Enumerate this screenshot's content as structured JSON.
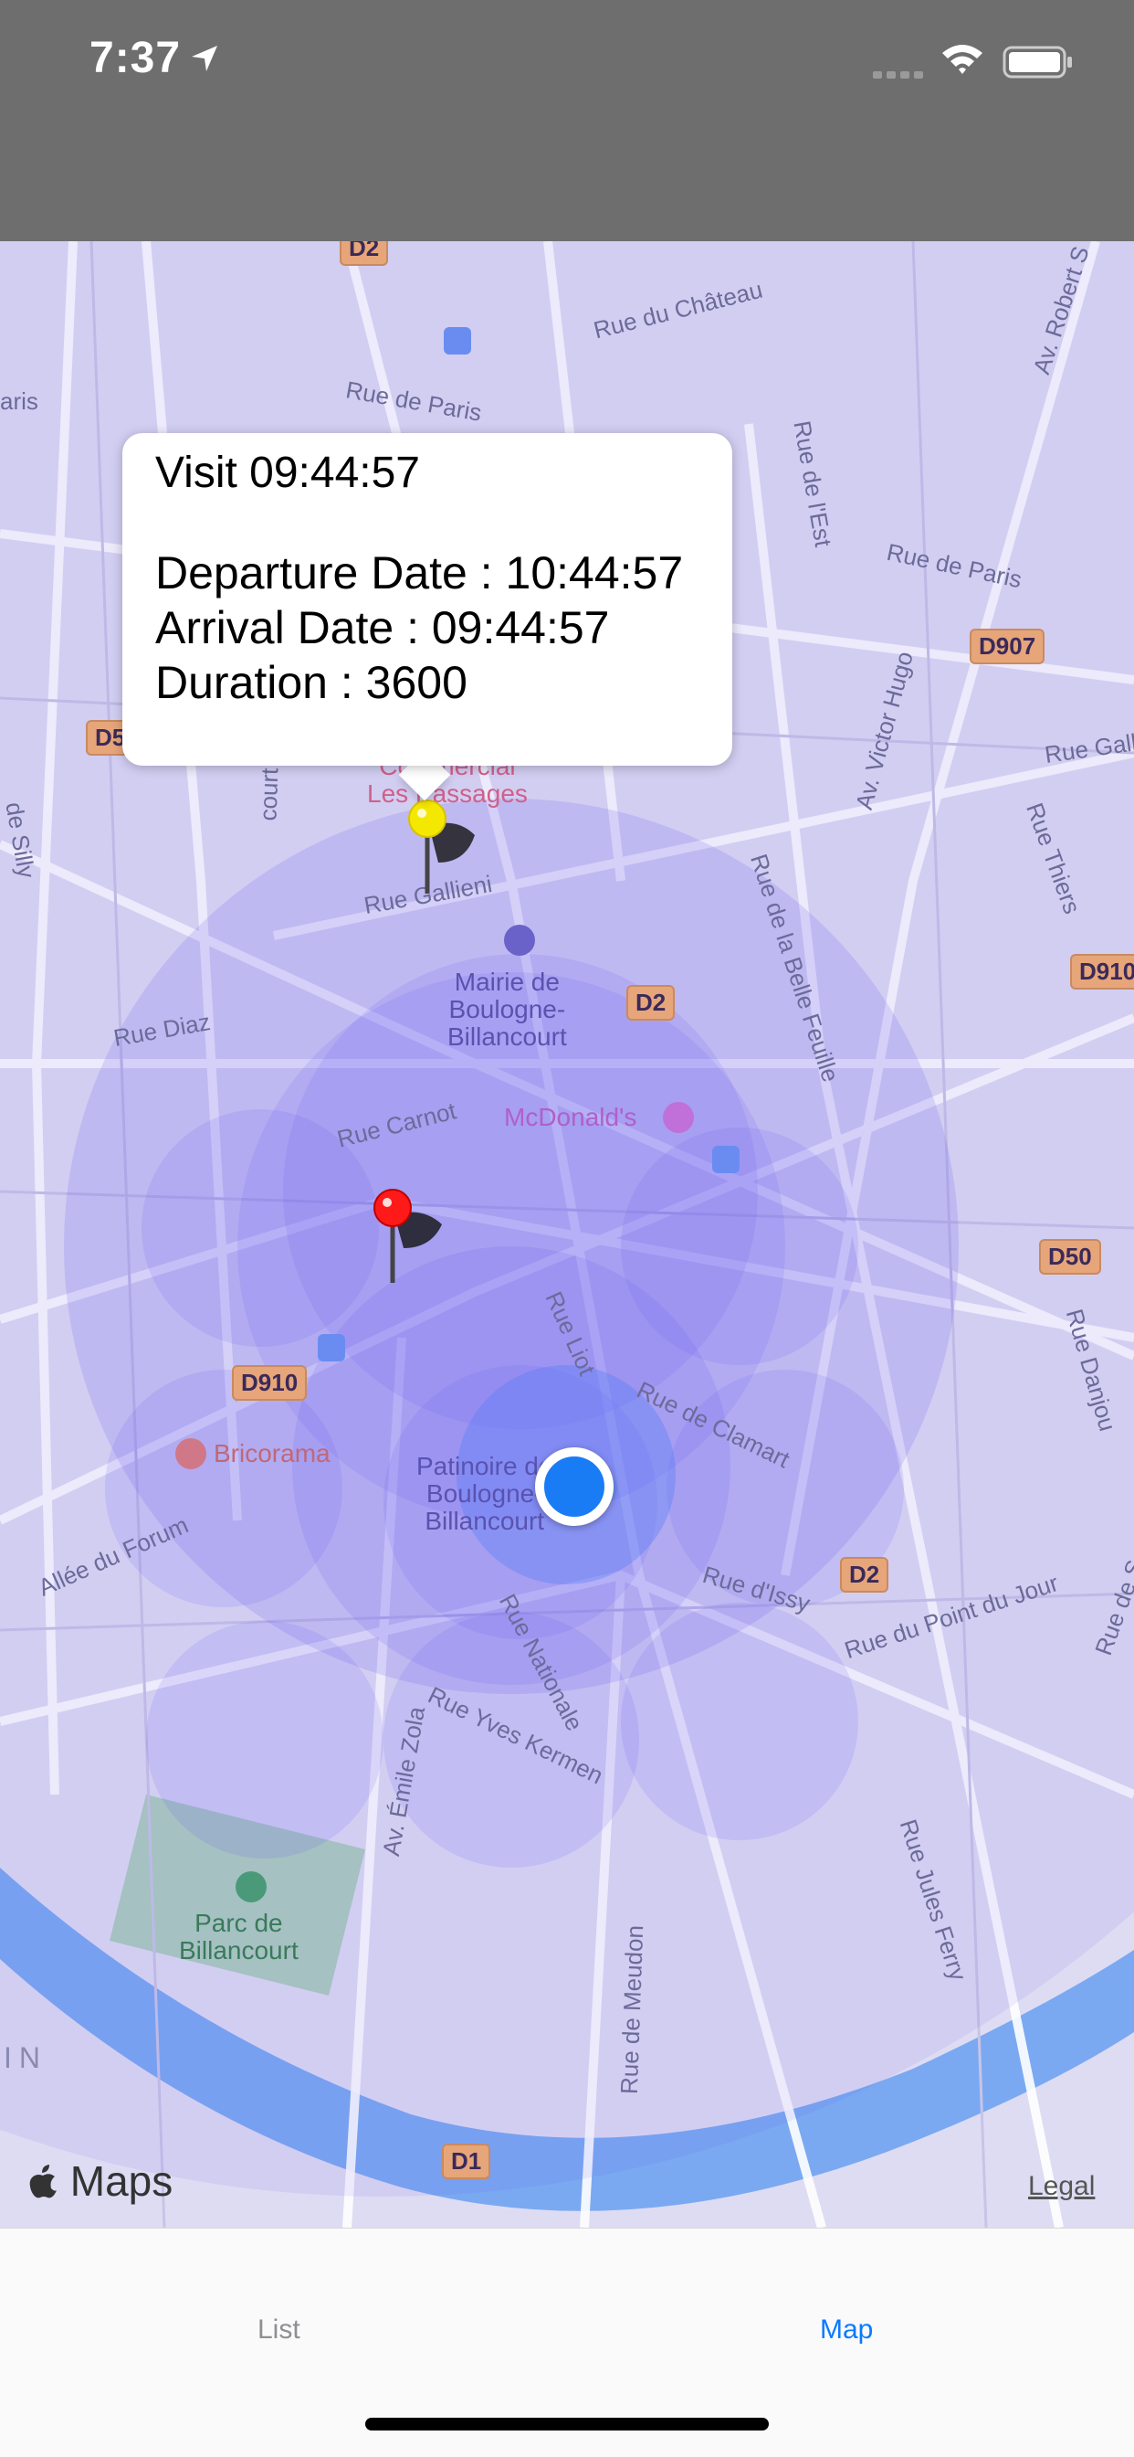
{
  "status_bar": {
    "time": "7:37",
    "icons": [
      "location-arrow-icon",
      "cellular-signal-icon",
      "wifi-icon",
      "battery-icon"
    ]
  },
  "map": {
    "callout": {
      "title": "Visit 09:44:57",
      "departure": "Departure Date : 10:44:57",
      "arrival": "Arrival Date : 09:44:57",
      "duration": "Duration : 3600"
    },
    "streets": [
      "Rue du Château",
      "Av. Robert S",
      "Rue de Paris",
      "Rue de Paris",
      "Rue de l'Est",
      "Rue Gall",
      "Av. Victor Hugo",
      "Rue Thiers",
      "Rue de la Belle Feuille",
      "Rue Gallieni",
      "Rue Diaz",
      "Rue Carnot",
      "Rue Liot",
      "Rue de Clamart",
      "Rue Danjou",
      "Rue d'Issy",
      "Rue du Point du Jour",
      "Rue de S",
      "Allée du Forum",
      "Rue Nationale",
      "Rue Yves Kermen",
      "Av. Émile Zola",
      "Rue de Meudon",
      "Rue Jules Ferry",
      "court",
      "aris",
      "de Silly"
    ],
    "pois": {
      "mairie": "Mairie de\nBoulogne-\nBillancourt",
      "mcdonalds": "McDonald's",
      "bricorama": "Bricorama",
      "patinoire": "Patinoire de\nBoulogne-\nBillancourt",
      "parc": "Parc de\nBillancourt",
      "passages": "Commercial\nLes Passages"
    },
    "shields": [
      "D2",
      "D907",
      "D5",
      "D2",
      "D910",
      "D910",
      "D50",
      "D2",
      "D1"
    ],
    "edge_label": "IN",
    "brand": "Maps",
    "legal": "Legal",
    "colors": {
      "geofence": "#6a5cf0",
      "user_location": "#1a7cf5",
      "water": "#7aa9f2",
      "park": "#9fc9b0"
    }
  },
  "tab_bar": {
    "tabs": [
      {
        "label": "List",
        "selected": false
      },
      {
        "label": "Map",
        "selected": true
      }
    ],
    "colors": {
      "selected": "#0a7aff",
      "unselected": "#8e8e93"
    }
  }
}
